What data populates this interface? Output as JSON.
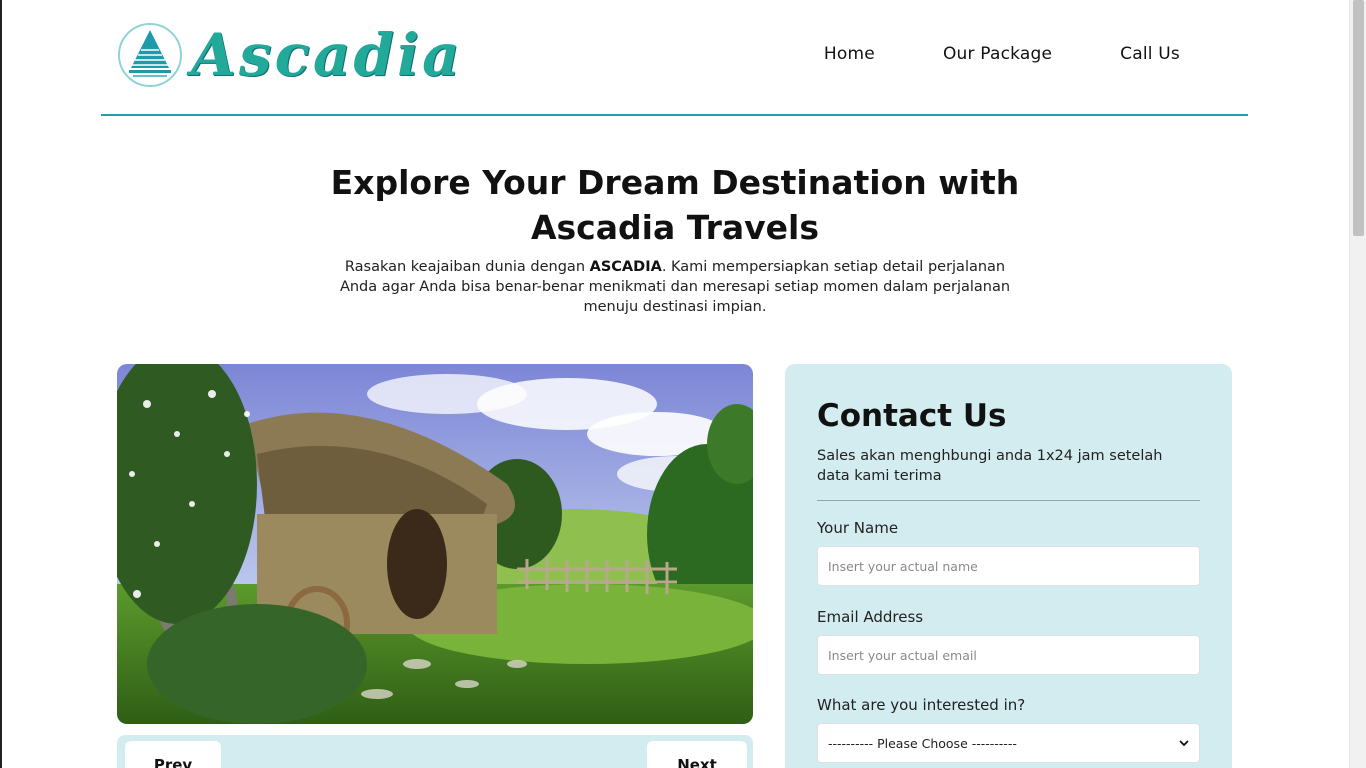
{
  "brand": {
    "name": "Ascadia",
    "accent": "#2a9bac",
    "logo_color": "#22a99a"
  },
  "nav": {
    "items": [
      {
        "label": "Home"
      },
      {
        "label": "Our Package"
      },
      {
        "label": "Call Us"
      }
    ]
  },
  "hero": {
    "title": "Explore Your Dream Destination with Ascadia Travels",
    "desc_before": "Rasakan keajaiban dunia dengan ",
    "desc_strong": "ASCADIA",
    "desc_after": ". Kami mempersiapkan setiap detail perjalanan Anda agar Anda bisa benar-benar menikmati dan meresapi setiap momen dalam perjalanan menuju destinasi impian."
  },
  "slider": {
    "prev_label": "Prev",
    "next_label": "Next"
  },
  "contact": {
    "title": "Contact Us",
    "subtitle": "Sales akan menghbungi anda 1x24 jam setelah data kami terima",
    "bg_color": "#d3ecef",
    "name": {
      "label": "Your Name",
      "placeholder": "Insert your actual name"
    },
    "email": {
      "label": "Email Address",
      "placeholder": "Insert your actual email"
    },
    "interest": {
      "label": "What are you interested in?",
      "selected": "---------- Please Choose ----------"
    }
  }
}
